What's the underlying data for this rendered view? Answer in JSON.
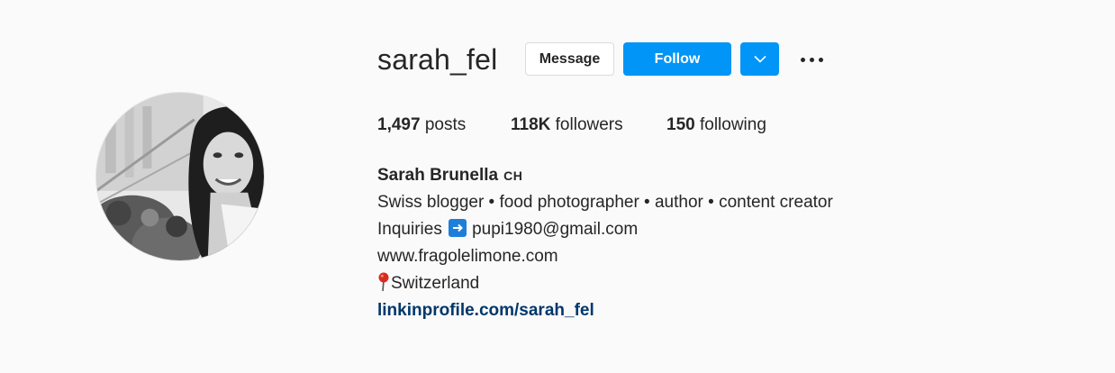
{
  "profile": {
    "username": "sarah_fel",
    "avatar_icon": "profile-photo",
    "actions": {
      "message_label": "Message",
      "follow_label": "Follow",
      "dropdown_icon": "chevron-down-icon",
      "more_icon": "more-options-icon"
    },
    "stats": {
      "posts_count": "1,497",
      "posts_label": "posts",
      "followers_count": "118K",
      "followers_label": "followers",
      "following_count": "150",
      "following_label": "following"
    },
    "bio": {
      "full_name": "Sarah Brunella",
      "country_code": "CH",
      "description": "Swiss blogger • food photographer • author • content creator",
      "inquiries_label": "Inquiries",
      "inquiries_icon": "right-arrow-emoji",
      "email": "pupi1980@gmail.com",
      "website": "www.fragolelimone.com",
      "location_icon": "round-pushpin-emoji",
      "location": "Switzerland",
      "external_link": "linkinprofile.com/sarah_fel"
    }
  },
  "colors": {
    "background": "#fafafa",
    "primary_blue": "#0095f6",
    "link_color": "#00376b",
    "text": "#262626"
  }
}
